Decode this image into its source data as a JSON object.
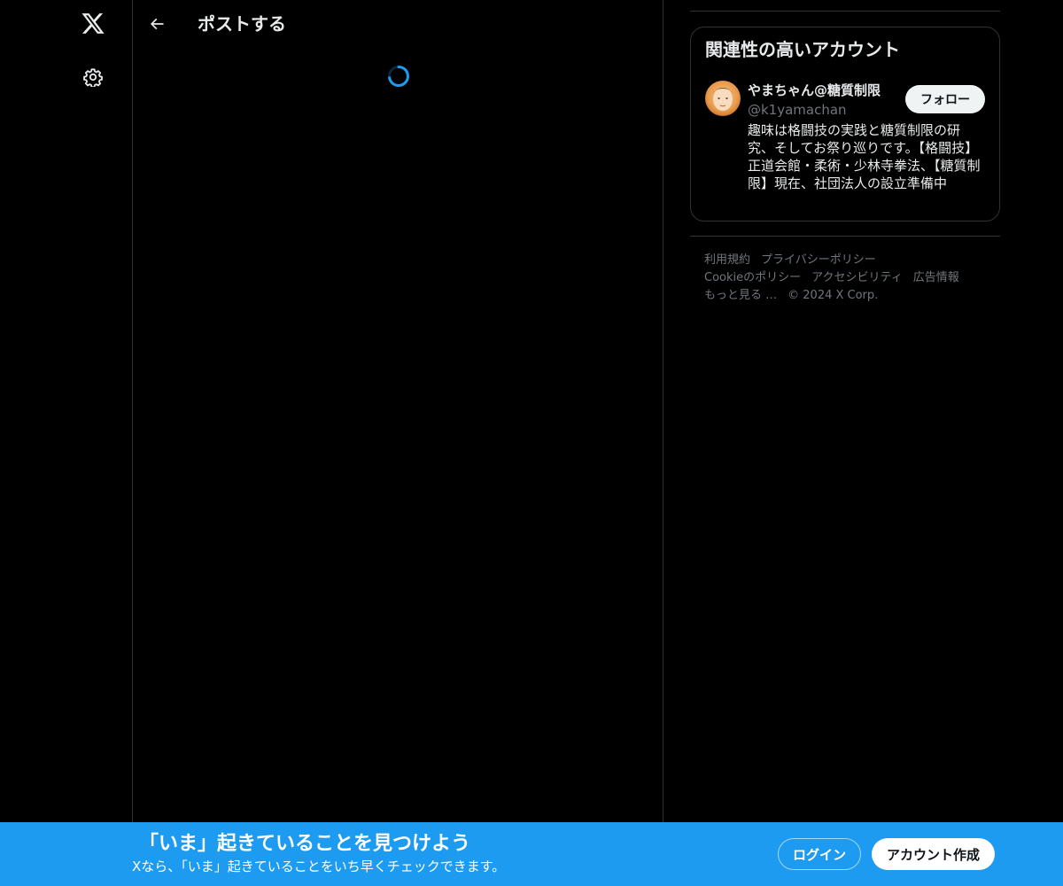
{
  "nav": {
    "logo_icon": "x-logo-icon",
    "settings_icon": "gear-icon"
  },
  "header": {
    "back_icon": "arrow-left-icon",
    "title": "ポストする"
  },
  "main": {
    "loading": true,
    "spinner_color": "#1d9bf0"
  },
  "sidebar": {
    "who_to_follow": {
      "title": "関連性の高いアカウント",
      "account": {
        "name": "やまちゃん@糖質制限",
        "handle": "@k1yamachan",
        "follow_label": "フォロー",
        "bio": "趣味は格闘技の実践と糖質制限の研究、そしてお祭り巡りです。【格闘技】正道会館・柔術・少林寺拳法、【糖質制限】現在、社団法人の設立準備中"
      }
    },
    "footer": {
      "links": [
        "利用規約",
        "プライバシーポリシー",
        "Cookieのポリシー",
        "アクセシビリティ",
        "広告情報",
        "もっと見る …"
      ],
      "copyright": "© 2024 X Corp."
    }
  },
  "banner": {
    "title": "「いま」起きていることを見つけよう",
    "subtitle": "Xなら、「いま」起きていることをいち早くチェックできます。",
    "login_label": "ログイン",
    "signup_label": "アカウント作成",
    "background": "#1d9bf0"
  }
}
